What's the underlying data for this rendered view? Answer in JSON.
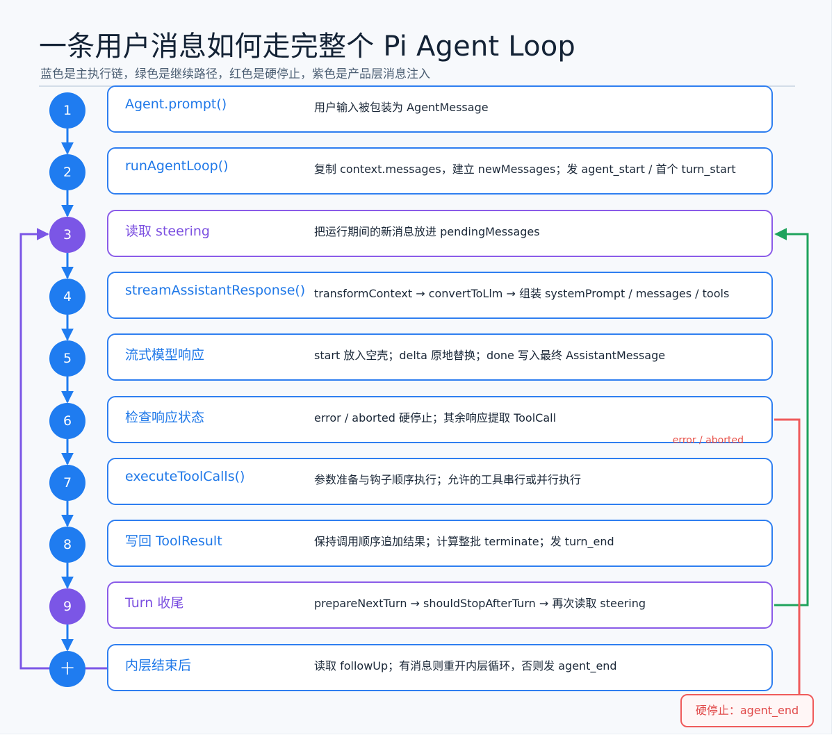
{
  "title": "一条用户消息如何走完整个 Pi Agent Loop",
  "subtitle": "蓝色是主执行链，绿色是继续路径，红色是硬停止，紫色是产品层消息注入",
  "colors": {
    "main_chain": "#1f7cf0",
    "continue_path": "#1fa35c",
    "hard_stop": "#ef5b5b",
    "message_injection": "#7b56e6"
  },
  "steps": [
    {
      "num": "1",
      "title": "Agent.prompt()",
      "desc": "用户输入被包装为 AgentMessage",
      "kind": "main"
    },
    {
      "num": "2",
      "title": "runAgentLoop()",
      "desc": "复制 context.messages，建立 newMessages；发 agent_start / 首个 turn_start",
      "kind": "main"
    },
    {
      "num": "3",
      "title": "读取 steering",
      "desc": "把运行期间的新消息放进 pendingMessages",
      "kind": "injection"
    },
    {
      "num": "4",
      "title": "streamAssistantResponse()",
      "desc": "transformContext → convertToLlm → 组装 systemPrompt / messages / tools",
      "kind": "main"
    },
    {
      "num": "5",
      "title": "流式模型响应",
      "desc": "start 放入空壳；delta 原地替换；done 写入最终 AssistantMessage",
      "kind": "main"
    },
    {
      "num": "6",
      "title": "检查响应状态",
      "desc": "error / aborted 硬停止；其余响应提取 ToolCall",
      "kind": "main",
      "note": "error / aborted"
    },
    {
      "num": "7",
      "title": "executeToolCalls()",
      "desc": "参数准备与钩子顺序执行；允许的工具串行或并行执行",
      "kind": "main"
    },
    {
      "num": "8",
      "title": "写回 ToolResult",
      "desc": "保持调用顺序追加结果；计算整批 terminate；发 turn_end",
      "kind": "main"
    },
    {
      "num": "9",
      "title": "Turn 收尾",
      "desc": "prepareNextTurn → shouldStopAfterTurn → 再次读取 steering",
      "kind": "injection"
    },
    {
      "num": "十",
      "title": "内层结束后",
      "desc": "读取 followUp；有消息则重开内层循环，否则发 agent_end",
      "kind": "main"
    }
  ],
  "hard_stop_label": "硬停止：agent_end"
}
